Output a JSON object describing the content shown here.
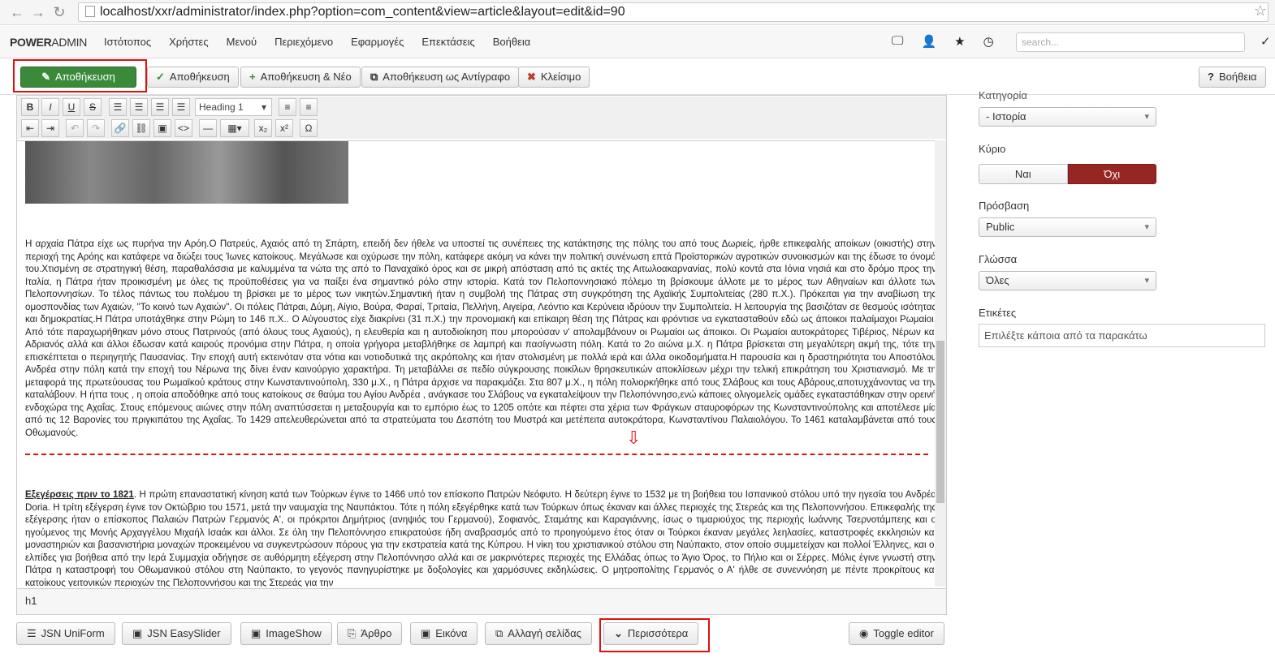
{
  "browser": {
    "url": "localhost/xxr/administrator/index.php?option=com_content&view=article&layout=edit&id=90"
  },
  "navbar": {
    "brand_bold": "POWER",
    "brand_light": "ADMIN",
    "menu": [
      "Ιστότοπος",
      "Χρήστες",
      "Μενού",
      "Περιεχόμενο",
      "Εφαρμογές",
      "Επεκτάσεις",
      "Βοήθεια"
    ],
    "search_placeholder": "search..."
  },
  "toolbar": {
    "save_primary": "Αποθήκευση",
    "save": "Αποθήκευση",
    "save_new": "Αποθήκευση & Νέο",
    "save_copy": "Αποθήκευση ως Αντίγραφο",
    "close": "Κλείσιμο",
    "help": "Βοήθεια"
  },
  "editor": {
    "format": "Heading 1",
    "paragraph1": " Η αρχαία Πάτρα είχε ως πυρήνα την Αρόη.Ο Πατρεύς, Αχαιός από τη Σπάρτη, επειδή δεν ήθελε να υποστεί τις συνέπειες της κατάκτησης της πόλης του από τους Δωριείς, ήρθε επικεφαλής αποίκων (οικιστής) στην περιοχή της Αρόης και κατάφερε να διώξει τους Ίωνες κατοίκους. Μεγάλωσε και οχύρωσε την πόλη, κατάφερε ακόμη να κάνει την πολιτική συνένωση επτά Προϊστορικών αγροτικών συνοικισμών και της έδωσε το όνομά του.Χτισμένη σε στρατηγική θέση, παραθαλάσσια με καλυμμένα τα νώτα της από το Παναχαϊκό όρος και σε μικρή απόσταση από τις ακτές της Αιτωλοακαρνανίας, πολύ κοντά στα Ιόνια νησιά και στο δρόμο προς την Ιταλία, η Πάτρα ήταν προικισμένη με όλες τις προϋποθέσεις για να παίξει ένα σημαντικό ρόλο στην ιστορία. Κατά τον Πελοποννησιακό πόλεμο τη βρίσκουμε άλλοτε με το μέρος των Αθηναίων και άλλοτε των Πελοποννησίων. Το τέλος πάντως του πολέμου τη βρίσκει με το μέρος των νικητών.Σημαντική ήταν η συμβολή της Πάτρας στη συγκρότηση της Αχαϊκής Συμπολιτείας (280 π.Χ.). Πρόκειται για την αναβίωση της ομοσπονδίας των Αχαιών, \"Το κοινό των Αχαιών\". Οι πόλεις Πάτραι, Δύμη, Αίγιο, Βούρα, Φαραί, Τριταία, Πελλήνη, Αιγείρα, Λεόντιο και Κερύνεια ιδρύουν την Συμπολιτεία. Η λειτουργία της βασιζόταν σε θεσμούς ισότητας και δημοκρατίας.Η Πάτρα υποτάχθηκε στην Ρώμη το 146 π.Χ.. Ο Αύγουστος είχε διακρίνει (31 π.Χ.) την προνομιακή και επίκαιρη θέση της Πάτρας και φρόντισε να εγκατασταθούν εδώ ως άποικοι παλαίμαχοι Ρωμαίοι. Από τότε παραχωρήθηκαν μόνο στους Πατρινούς (από όλους τους Αχαιούς), η ελευθερία και η αυτοδιοίκηση που μπορούσαν ν' απολαμβάνουν οι Ρωμαίοι ως άποικοι. Οι Ρωμαίοι αυτοκράτορες Τιβέριος, Νέρων και Αδριανός αλλά και άλλοι έδωσαν κατά καιρούς προνόμια στην Πάτρα, η οποία γρήγορα μεταβλήθηκε σε λαμπρή και πασίγνωστη πόλη. Κατά το 2ο αιώνα μ.Χ. η Πάτρα βρίσκεται στη μεγαλύτερη ακμή της, τότε την επισκέπτεται ο περιηγητής Παυσανίας. Την εποχή αυτή εκτεινόταν στα νότια και νοτιοδυτικά της ακρόπολης και ήταν στολισμένη με πολλά ιερά και άλλα οικοδομήματα.Η παρουσία και η δραστηριότητα του Αποστόλου Ανδρέα στην πόλη κατά την εποχή του Νέρωνα της δίνει έναν καινούργιο χαρακτήρα. Τη μεταβάλλει σε πεδίο σύγκρουσης ποικίλων θρησκευτικών αποκλίσεων μέχρι την τελική επικράτηση του Χριστιανισμό. Με τη μεταφορά της πρωτεύουσας του Ρωμαϊκού κράτους στην Κωνσταντινούπολη, 330 μ.Χ., η Πάτρα άρχισε να παρακμάζει. Στα 807 μ.Χ., η πόλη πολιορκήθηκε από τους Σλάβους και τους Αβάρους,αποτυχχάνοντας να την καταλάβουν. Η ήττα τους , η οποία αποδόθηκε από τους κατοίκους σε θαύμα του Αγίου Ανδρέα , ανάγκασε του Σλάβους να εγκαταλείψουν την Πελοπόννησο,ενώ κάποιες ολιγομελείς ομάδες εγκαταστάθηκαν στην ορεινή ενδοχώρα της Αχαΐας. Στους επόμενους αιώνες στην πόλη αναπτύσσεται η μεταξουργία και το εμπόριο έως το 1205 οπότε και πέφτει στα χέρια των Φράγκων σταυροφόρων της Κωνσταντινούπολης και αποτέλεσε μία από τις 12 Βαρονίες του πριγκιπάτου της Αχαΐας. Το 1429 απελευθερώνεται από τα στρατεύματα του Δεσπότη του Μυστρά και μετέπειτα αυτοκράτορα, Κωνσταντίνου Παλαιολόγου. Το 1461 καταλαμβάνεται από τους Οθωμανούς.",
    "heading2": "Εξεγέρσεις πριν το 1821",
    "paragraph2": ". Η πρώτη επαναστατική κίνηση κατά των Τούρκων έγινε το 1466 υπό τον επίσκοπο Πατρών Νεόφυτο. Η δεύτερη έγινε το 1532 με τη βοήθεια του Ισπανικού στόλου υπό την ηγεσία του Ανδρέα Doria. Η τρίτη εξέγερση έγινε τον Οκτώβριο του 1571, μετά την ναυμαχία της Ναυπάκτου. Τότε η πόλη εξεγέρθηκε κατά των Τούρκων όπως έκαναν και άλλες περιοχές της Στερεάς και της Πελοποννήσου. Επικεφαλής της εξέγερσης ήταν ο επίσκοπος Παλαιών Πατρών Γερμανός Α', οι πρόκριτοι Δημήτριος (ανηψιός του Γερμανού), Σοφιανός, Σταμάτης και Καραγιάννης, ίσως ο τιμαριούχος της περιοχής Ιωάννης Τσερνοτάμπεης και ο ηγούμενος της Μονής Αρχαγγέλου Μιχαήλ Ισαάκ και άλλοι. Σε όλη την Πελοπόννησο επικρατούσε ήδη αναβρασμός από το προηγούμενο έτος όταν οι Τούρκοι έκαναν μεγάλες λεηλασίες, καταστροφές εκκλησιών και μοναστηριών και βασανιστήρια μοναχών προκειμένου να συγκεντρώσουν πόρους για την εκστρατεία κατά της Κύπρου. Η νίκη του χριστιανικού στόλου στη Ναύπακτο, στον οποίο συμμετείχαν και πολλοί Έλληνες, και οι ελπίδες για βοήθεια από την Ιερά Συμμαχία οδήγησε σε αυθόρμητη εξέγερση στην Πελοπόννησο αλλά και σε μακρινότερες περιοχές της Ελλάδας όπως το Άγιο Όρος, το Πήλιο και οι Σέρρες. Μόλις έγινε γνωστή στην Πάτρα η καταστροφή του Οθωμανικού στόλου στη Ναύπακτο, το γεγονός πανηγυρίστηκε με δοξολογίες και χαρμόσυνες εκδηλώσεις. Ο μητροπολίτης Γερμανός ο Α' ήλθε σε συνεννόηση με πέντε προκρίτους και κατοίκους γειτονικών περιοχών της Πελοποννήσου και της Στερεάς για την",
    "status_path": "h1"
  },
  "sidebar": {
    "category_label": "Κατηγορία",
    "category_value": "- Ιστορία",
    "featured_label": "Κύριο",
    "featured_yes": "Ναι",
    "featured_no": "Όχι",
    "access_label": "Πρόσβαση",
    "access_value": "Public",
    "language_label": "Γλώσσα",
    "language_value": "Όλες",
    "tags_label": "Ετικέτες",
    "tags_placeholder": "Επιλέξτε κάποια από τα παρακάτω"
  },
  "bottom_buttons": {
    "uniform": "JSN UniForm",
    "easyslider": "JSN EasySlider",
    "imageshow": "ImageShow",
    "article": "Άρθρο",
    "image": "Εικόνα",
    "pagebreak": "Αλλαγή σελίδας",
    "more": "Περισσότερα",
    "toggle": "Toggle editor"
  }
}
